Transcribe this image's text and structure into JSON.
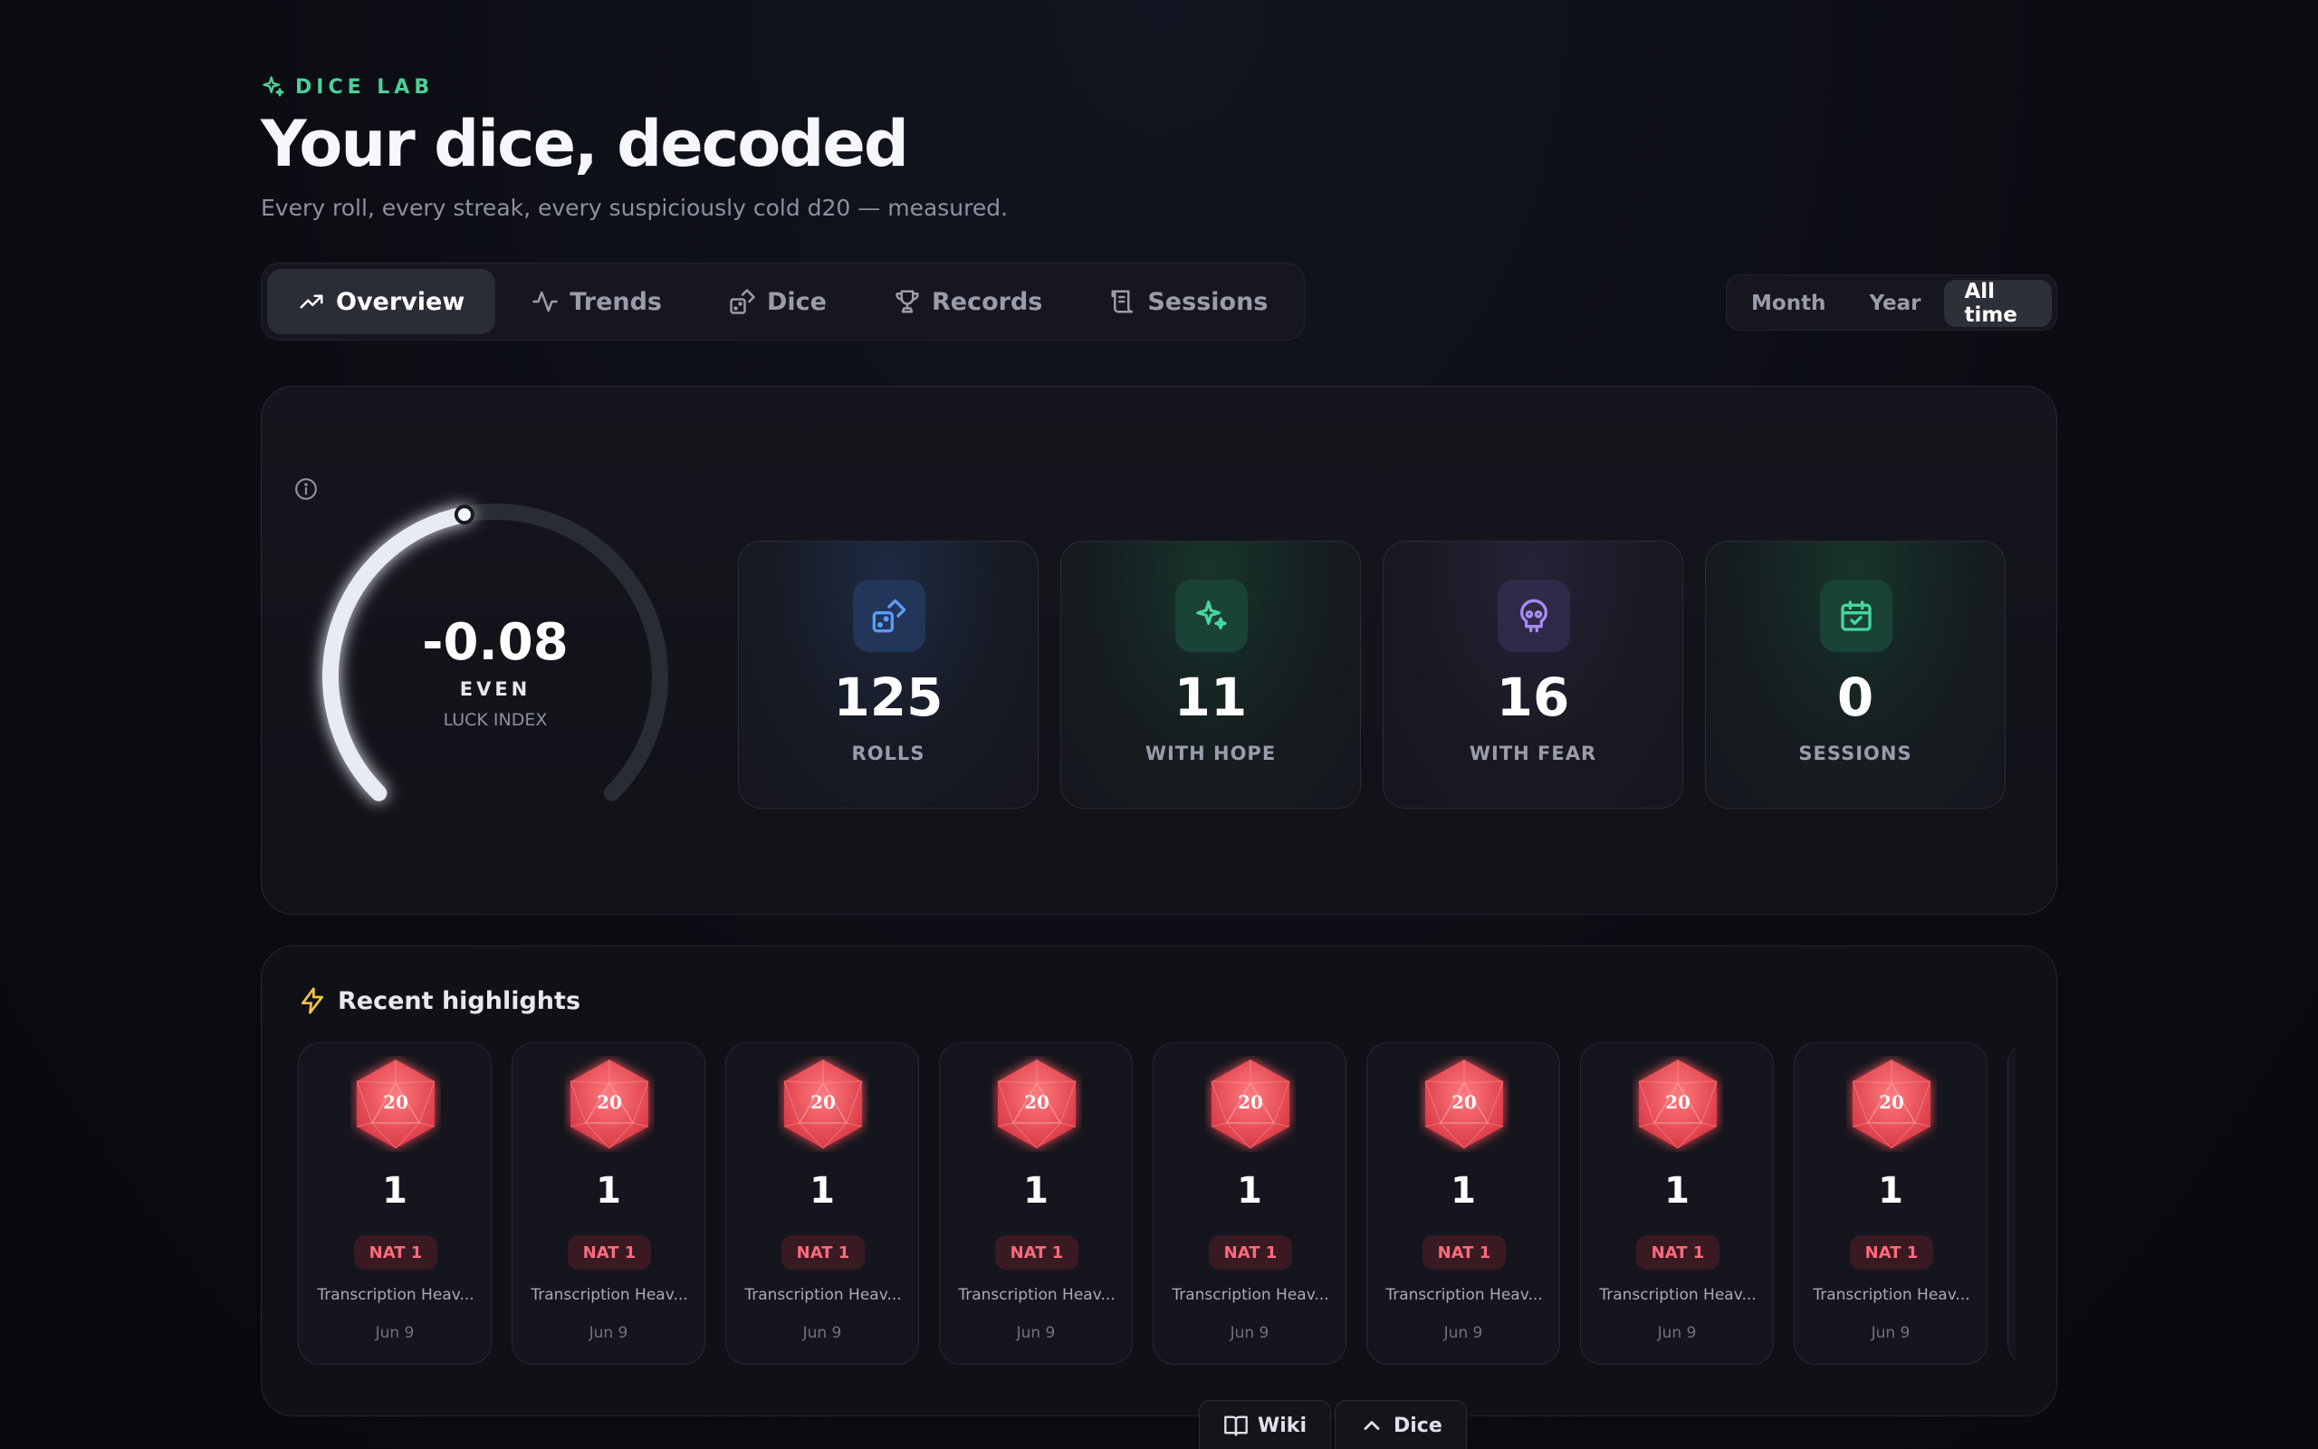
{
  "header": {
    "eyebrow": "DICE LAB",
    "title": "Your dice, decoded",
    "subtitle": "Every roll, every streak, every suspiciously cold d20 — measured."
  },
  "tabs": [
    {
      "label": "Overview",
      "icon": "trending-up-icon",
      "active": true
    },
    {
      "label": "Trends",
      "icon": "activity-icon",
      "active": false
    },
    {
      "label": "Dice",
      "icon": "dice-icon",
      "active": false
    },
    {
      "label": "Records",
      "icon": "trophy-icon",
      "active": false
    },
    {
      "label": "Sessions",
      "icon": "scroll-icon",
      "active": false
    }
  ],
  "range": {
    "options": [
      "Month",
      "Year",
      "All time"
    ],
    "selected": "All time"
  },
  "luck": {
    "value": "-0.08",
    "verdict": "EVEN",
    "label": "LUCK INDEX",
    "gauge_fraction": 0.46
  },
  "stats": [
    {
      "value": "125",
      "label": "ROLLS",
      "icon": "dice-icon"
    },
    {
      "value": "11",
      "label": "WITH HOPE",
      "icon": "sparkles-icon"
    },
    {
      "value": "16",
      "label": "WITH FEAR",
      "icon": "skull-icon"
    },
    {
      "value": "0",
      "label": "SESSIONS",
      "icon": "calendar-check-icon"
    }
  ],
  "highlights": {
    "title": "Recent highlights",
    "items": [
      {
        "die": "20",
        "roll": "1",
        "badge": "NAT 1",
        "source": "Transcription Heav...",
        "date": "Jun 9"
      },
      {
        "die": "20",
        "roll": "1",
        "badge": "NAT 1",
        "source": "Transcription Heav...",
        "date": "Jun 9"
      },
      {
        "die": "20",
        "roll": "1",
        "badge": "NAT 1",
        "source": "Transcription Heav...",
        "date": "Jun 9"
      },
      {
        "die": "20",
        "roll": "1",
        "badge": "NAT 1",
        "source": "Transcription Heav...",
        "date": "Jun 9"
      },
      {
        "die": "20",
        "roll": "1",
        "badge": "NAT 1",
        "source": "Transcription Heav...",
        "date": "Jun 9"
      },
      {
        "die": "20",
        "roll": "1",
        "badge": "NAT 1",
        "source": "Transcription Heav...",
        "date": "Jun 9"
      },
      {
        "die": "20",
        "roll": "1",
        "badge": "NAT 1",
        "source": "Transcription Heav...",
        "date": "Jun 9"
      },
      {
        "die": "20",
        "roll": "1",
        "badge": "NAT 1",
        "source": "Transcription Heav...",
        "date": "Jun 9"
      }
    ]
  },
  "dock": {
    "wiki": "Wiki",
    "dice": "Dice"
  },
  "colors": {
    "accent": "#4fcf98",
    "nat1": "#ff6a7b",
    "die_red": "#f04e57"
  }
}
